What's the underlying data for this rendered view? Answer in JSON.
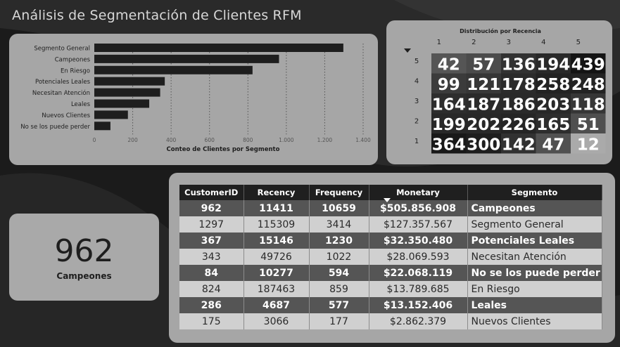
{
  "title": "Análisis de Segmentación de Clientes RFM",
  "bar_chart": {
    "chart_data": {
      "type": "bar",
      "orientation": "horizontal",
      "categories": [
        "Segmento General",
        "Campeones",
        "En Riesgo",
        "Potenciales Leales",
        "Necesitan Atención",
        "Leales",
        "Nuevos Clientes",
        "No se los puede perder"
      ],
      "values": [
        1297,
        962,
        824,
        367,
        343,
        286,
        175,
        84
      ],
      "xlabel": "Conteo de Clientes por Segmento",
      "xticks": [
        "0",
        "200",
        "400",
        "600",
        "800",
        "1.000",
        "1.200",
        "1.400"
      ],
      "xlim": [
        0,
        1400
      ],
      "bar_color": "#1e1e1e",
      "grid": true
    }
  },
  "heatmap": {
    "chart_data": {
      "type": "heatmap",
      "title": "Distribución por Recencia",
      "columns": [
        "1",
        "2",
        "3",
        "4",
        "5"
      ],
      "rows": [
        "5",
        "4",
        "3",
        "2",
        "1"
      ],
      "values": [
        [
          42,
          57,
          136,
          194,
          439
        ],
        [
          99,
          121,
          178,
          258,
          248
        ],
        [
          164,
          187,
          186,
          203,
          118
        ],
        [
          199,
          202,
          226,
          165,
          51
        ],
        [
          364,
          300,
          142,
          47,
          12
        ]
      ]
    }
  },
  "kpi": {
    "value": "962",
    "label": "Campeones"
  },
  "table": {
    "headers": [
      "CustomerID",
      "Recency",
      "Frequency",
      "Monetary",
      "Segmento"
    ],
    "sorted_column": "Monetary",
    "rows": [
      {
        "customer_id": "962",
        "recency": "11411",
        "frequency": "10659",
        "monetary": "$505.856.908",
        "segmento": "Campeones",
        "style": "dark"
      },
      {
        "customer_id": "1297",
        "recency": "115309",
        "frequency": "3414",
        "monetary": "$127.357.567",
        "segmento": "Segmento General",
        "style": "light"
      },
      {
        "customer_id": "367",
        "recency": "15146",
        "frequency": "1230",
        "monetary": "$32.350.480",
        "segmento": "Potenciales Leales",
        "style": "dark"
      },
      {
        "customer_id": "343",
        "recency": "49726",
        "frequency": "1022",
        "monetary": "$28.069.593",
        "segmento": "Necesitan Atención",
        "style": "light"
      },
      {
        "customer_id": "84",
        "recency": "10277",
        "frequency": "594",
        "monetary": "$22.068.119",
        "segmento": "No se los puede perder",
        "style": "dark"
      },
      {
        "customer_id": "824",
        "recency": "187463",
        "frequency": "859",
        "monetary": "$13.789.685",
        "segmento": "En Riesgo",
        "style": "light"
      },
      {
        "customer_id": "286",
        "recency": "4687",
        "frequency": "577",
        "monetary": "$13.152.406",
        "segmento": "Leales",
        "style": "dark"
      },
      {
        "customer_id": "175",
        "recency": "3066",
        "frequency": "177",
        "monetary": "$2.862.379",
        "segmento": "Nuevos Clientes",
        "style": "light"
      }
    ]
  }
}
